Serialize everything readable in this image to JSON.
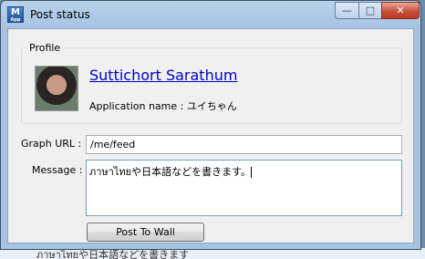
{
  "window": {
    "title": "Post status",
    "icon_text": "M",
    "icon_subtext": "App",
    "controls": {
      "minimize": "—",
      "maximize": "□",
      "close": "✕"
    }
  },
  "profile": {
    "legend": "Profile",
    "user_name": "Suttichort Sarathum",
    "app_label": "Application name : ",
    "app_name": "ユイちゃん"
  },
  "form": {
    "graph_url_label": "Graph URL :",
    "graph_url_value": "/me/feed",
    "message_label": "Message :",
    "message_value": "ภาษาไทยや日本語などを書きます。"
  },
  "buttons": {
    "post": "Post To Wall"
  },
  "background": {
    "text": "ภาษาไทยや日本語などを書きます"
  }
}
